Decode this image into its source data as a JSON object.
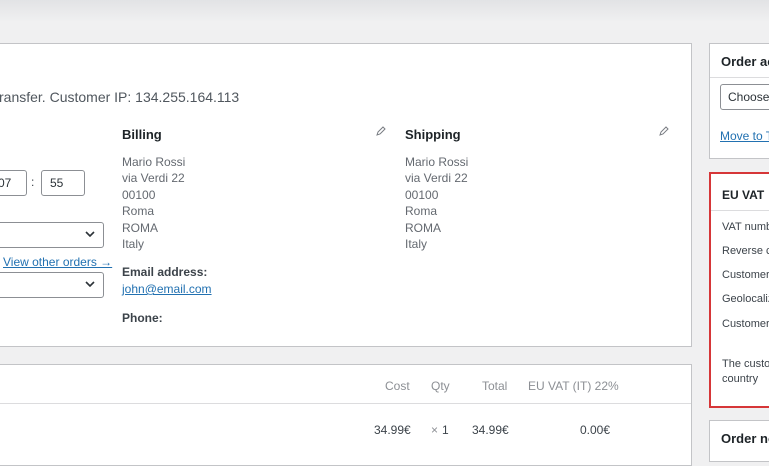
{
  "order": {
    "subtitle": "ransfer. Customer IP: 134.255.164.113",
    "date": {
      "hour": "07",
      "separator": ":",
      "minute": "55"
    },
    "view_other_orders": "View other orders →"
  },
  "billing": {
    "title": "Billing",
    "address": [
      "Mario Rossi",
      "via Verdi 22",
      "00100",
      "Roma",
      "ROMA",
      "Italy"
    ],
    "email_label": "Email address:",
    "email": "john@email.com",
    "phone_label": "Phone:"
  },
  "shipping": {
    "title": "Shipping",
    "address": [
      "Mario Rossi",
      "via Verdi 22",
      "00100",
      "Roma",
      "ROMA",
      "Italy"
    ]
  },
  "items": {
    "headers": {
      "cost": "Cost",
      "qty": "Qty",
      "total": "Total",
      "vat": "EU VAT (IT) 22%"
    },
    "row": {
      "cost": "34.99€",
      "qty_x": "×",
      "qty": "1",
      "total": "34.99€",
      "vat": "0.00€"
    }
  },
  "order_actions": {
    "title": "Order ac",
    "select_value": "Choose",
    "move_link": "Move to T"
  },
  "eu_vat": {
    "title": "EU VAT",
    "rows": [
      "VAT numb",
      "Reverse c",
      "Customer",
      "Geolocaliz",
      "Customer"
    ],
    "note": [
      "The custo",
      "country"
    ]
  },
  "order_notes": {
    "title": "Order no"
  },
  "colors": {
    "accent": "#2271b1",
    "highlight": "#d63638"
  },
  "icons": {
    "edit": "pencil-icon",
    "select": "chevron-down-icon"
  }
}
